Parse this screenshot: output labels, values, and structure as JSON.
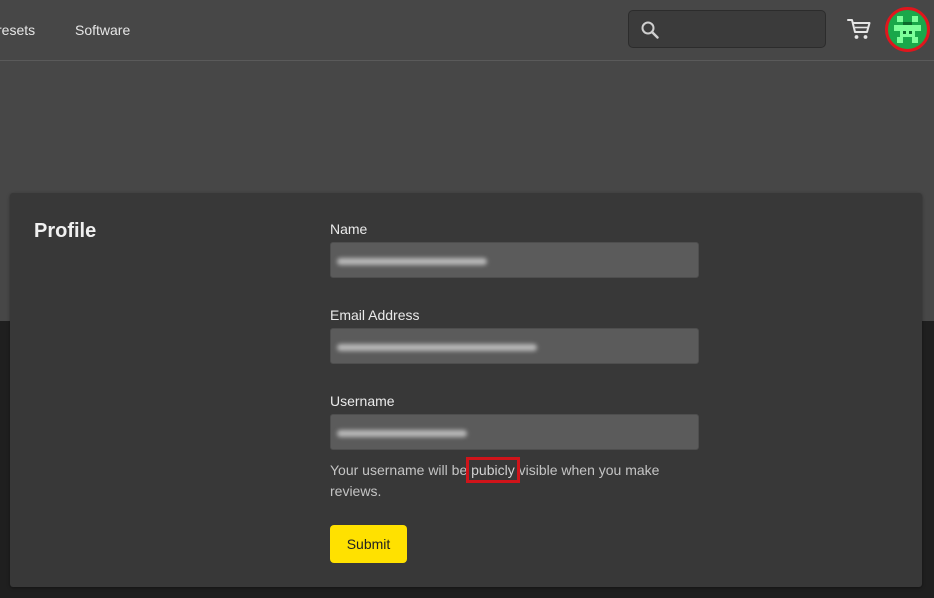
{
  "nav": {
    "links": [
      {
        "label": "resets"
      },
      {
        "label": "Software"
      }
    ],
    "search": {
      "value": "",
      "placeholder": ""
    }
  },
  "profile": {
    "title": "Profile",
    "fields": {
      "name": {
        "label": "Name"
      },
      "email": {
        "label": "Email Address"
      },
      "username": {
        "label": "Username"
      }
    },
    "help_text": {
      "before": "Your username will be ",
      "highlight": "pubicly",
      "after": " visible when you make reviews."
    },
    "submit_label": "Submit"
  },
  "colors": {
    "accent": "#ffe100",
    "annotation": "#d0141a",
    "avatar_green": "#1aa84a"
  }
}
